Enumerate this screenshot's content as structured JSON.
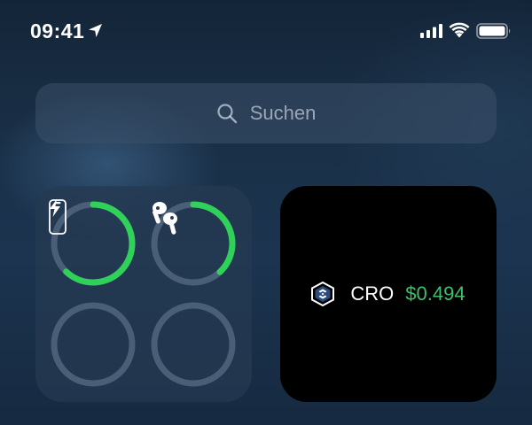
{
  "status_bar": {
    "time": "09:41",
    "icons": [
      "location-arrow-icon",
      "cellular-signal-icon",
      "wifi-icon",
      "battery-icon"
    ]
  },
  "search": {
    "icon": "search-icon",
    "placeholder": "Suchen"
  },
  "battery_widget": {
    "ring_color": "#30d158",
    "track_color": "#4a5e78",
    "devices": [
      {
        "name": "iPhone",
        "icon": "iphone-icon",
        "level": 0.62,
        "charging": true
      },
      {
        "name": "AirPods",
        "icon": "airpods-icon",
        "level": 0.38,
        "charging": false
      },
      {
        "name": "",
        "icon": "",
        "level": 0,
        "charging": false
      },
      {
        "name": "",
        "icon": "",
        "level": 0,
        "charging": false
      }
    ]
  },
  "crypto_widget": {
    "icon": "cro-logo-icon",
    "ticker": "CRO",
    "price": "$0.494",
    "price_color": "#3fbf6a"
  }
}
